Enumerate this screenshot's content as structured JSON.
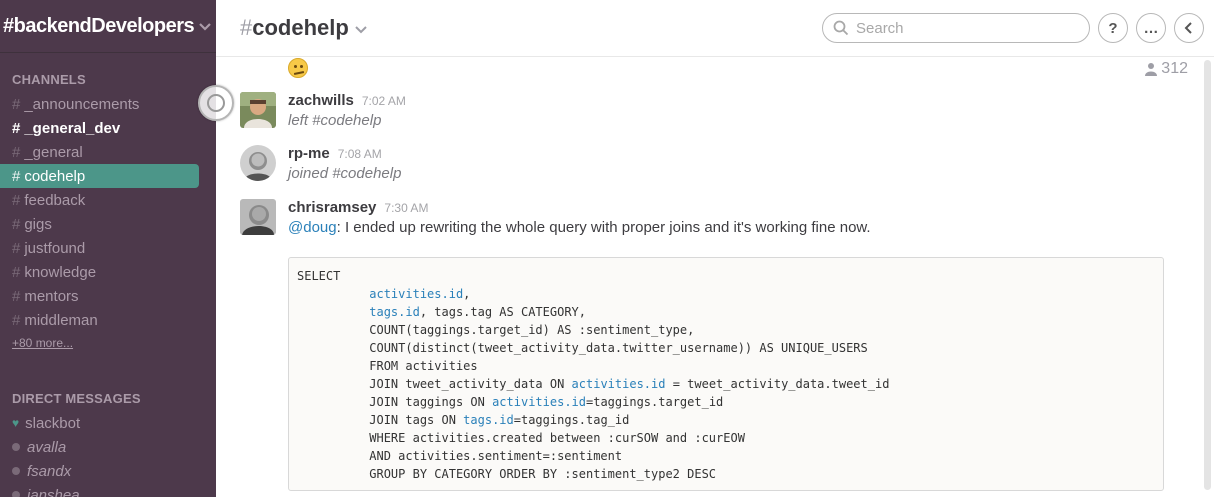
{
  "team": {
    "name": "#backendDevelopers"
  },
  "sidebar": {
    "channels_title": "CHANNELS",
    "channels": [
      {
        "name": "_announcements"
      },
      {
        "name": "_general_dev"
      },
      {
        "name": "_general"
      },
      {
        "name": "codehelp"
      },
      {
        "name": "feedback"
      },
      {
        "name": "gigs"
      },
      {
        "name": "justfound"
      },
      {
        "name": "knowledge"
      },
      {
        "name": "mentors"
      },
      {
        "name": "middleman"
      }
    ],
    "more_link": "+80 more...",
    "dms_title": "DIRECT MESSAGES",
    "dms": [
      {
        "name": "slackbot"
      },
      {
        "name": "avalla"
      },
      {
        "name": "fsandx"
      },
      {
        "name": "ianshea"
      }
    ]
  },
  "header": {
    "hash": "#",
    "channel": "codehelp",
    "search_placeholder": "Search",
    "help_label": "?",
    "more_label": "…",
    "back_label": "‹"
  },
  "members": {
    "count": "312"
  },
  "messages": [
    {
      "user": "zachwills",
      "time": "7:02 AM",
      "text": "left #codehelp"
    },
    {
      "user": "rp-me",
      "time": "7:08 AM",
      "text": "joined #codehelp"
    },
    {
      "user": "chrisramsey",
      "time": "7:30 AM",
      "mention": "@doug",
      "text": ": I ended up rewriting the whole query with proper joins and it's working fine  now."
    }
  ],
  "code": {
    "lines": [
      [
        "SELECT"
      ],
      [
        "          ",
        {
          "link": "activities.id"
        },
        ","
      ],
      [
        "          ",
        {
          "link": "tags.id"
        },
        ", tags.tag AS CATEGORY,"
      ],
      [
        "          COUNT(taggings.target_id) AS :sentiment_type,"
      ],
      [
        "          COUNT(distinct(tweet_activity_data.twitter_username)) AS UNIQUE_USERS"
      ],
      [
        "          FROM activities"
      ],
      [
        "          JOIN tweet_activity_data ON ",
        {
          "link": "activities.id"
        },
        " = tweet_activity_data.tweet_id"
      ],
      [
        "          JOIN taggings ON ",
        {
          "link": "activities.id"
        },
        "=taggings.target_id"
      ],
      [
        "          JOIN tags ON ",
        {
          "link": "tags.id"
        },
        "=taggings.tag_id"
      ],
      [
        "          WHERE activities.created between :curSOW and :curEOW"
      ],
      [
        "          AND activities.sentiment=:sentiment"
      ],
      [
        "          GROUP BY CATEGORY ORDER BY :sentiment_type2 DESC"
      ]
    ]
  },
  "colors": {
    "sidebar_bg": "#4d394b",
    "active_channel": "#4c9689",
    "link": "#2a80b9"
  }
}
